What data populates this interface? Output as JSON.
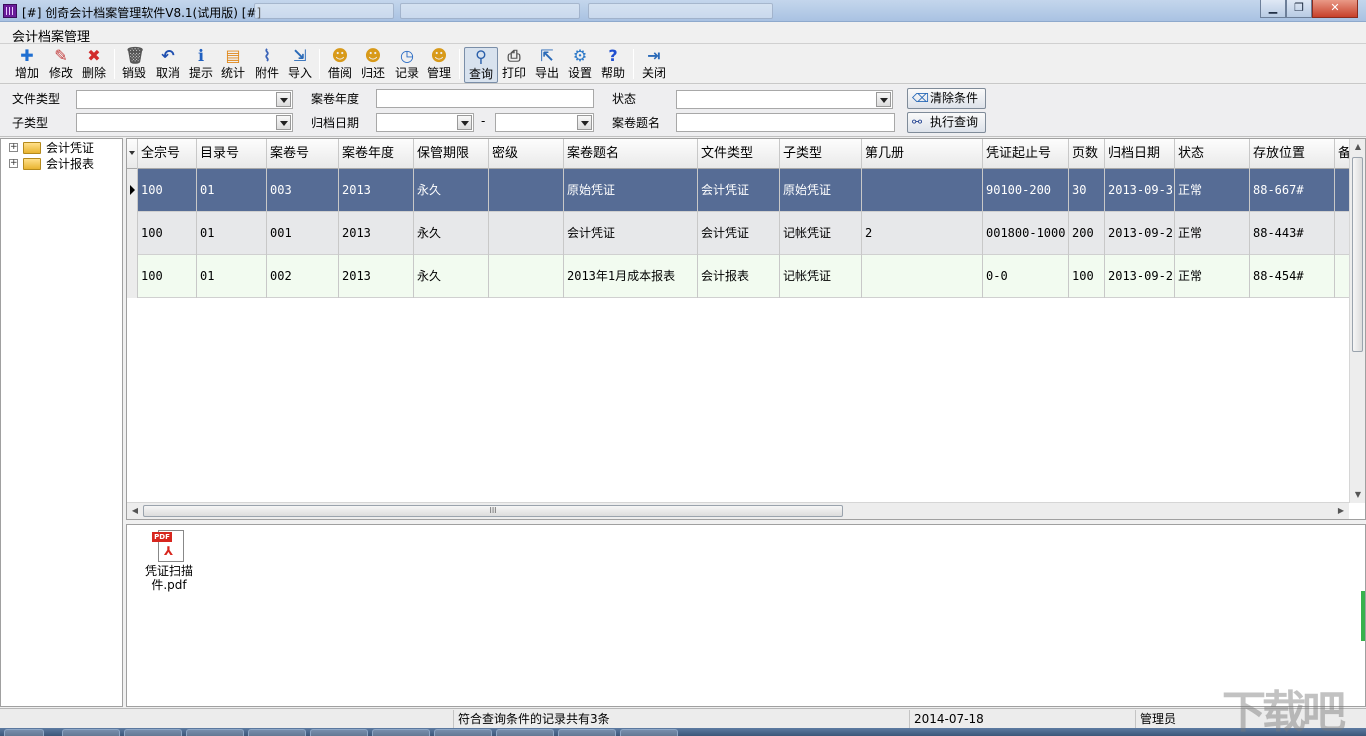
{
  "window": {
    "title": "[#] 创奇会计档案管理软件V8.1(试用版) [#]",
    "controls": {
      "minimize": "▁",
      "maximize": "❐",
      "close": "✕"
    }
  },
  "menu": {
    "title": "会计档案管理"
  },
  "toolbar": {
    "buttons": [
      {
        "label": "增加",
        "icon": "plus-icon",
        "glyph": "✚",
        "color": "#1f6fd1"
      },
      {
        "label": "修改",
        "icon": "pencil-icon",
        "glyph": "✎",
        "color": "#c23b3b"
      },
      {
        "label": "删除",
        "icon": "delete-x-icon",
        "glyph": "✖",
        "color": "#d22b2b"
      },
      {
        "label": "销毁",
        "icon": "trash-icon",
        "glyph": "🗑",
        "color": "#555555"
      },
      {
        "label": "取消",
        "icon": "undo-icon",
        "glyph": "↶",
        "color": "#1f4fb0"
      },
      {
        "label": "提示",
        "icon": "info-icon",
        "glyph": "ℹ",
        "color": "#1f5fc0"
      },
      {
        "label": "统计",
        "icon": "clipboard-icon",
        "glyph": "▤",
        "color": "#e0891c"
      },
      {
        "label": "附件",
        "icon": "paperclip-icon",
        "glyph": "⌇",
        "color": "#3a63b8"
      },
      {
        "label": "导入",
        "icon": "import-icon",
        "glyph": "⇲",
        "color": "#2a6ab8"
      },
      {
        "label": "借阅",
        "icon": "user-borrow-icon",
        "glyph": "☻",
        "color": "#d89a1a"
      },
      {
        "label": "归还",
        "icon": "user-return-icon",
        "glyph": "☻",
        "color": "#d89a1a"
      },
      {
        "label": "记录",
        "icon": "clock-icon",
        "glyph": "◷",
        "color": "#2b6cc4"
      },
      {
        "label": "管理",
        "icon": "user-manage-icon",
        "glyph": "☻",
        "color": "#d89a1a"
      },
      {
        "label": "查询",
        "icon": "magnifier-icon",
        "glyph": "⚲",
        "color": "#2a5faa"
      },
      {
        "label": "打印",
        "icon": "printer-icon",
        "glyph": "⎙",
        "color": "#555555"
      },
      {
        "label": "导出",
        "icon": "export-icon",
        "glyph": "⇱",
        "color": "#2a6ab8"
      },
      {
        "label": "设置",
        "icon": "gear-icon",
        "glyph": "⚙",
        "color": "#2b78c8"
      },
      {
        "label": "帮助",
        "icon": "help-icon",
        "glyph": "?",
        "color": "#1f4fd1"
      },
      {
        "label": "关闭",
        "icon": "exit-icon",
        "glyph": "⇥",
        "color": "#2a6ab8"
      }
    ]
  },
  "filters": {
    "file_type_label": "文件类型",
    "sub_type_label": "子类型",
    "year_label": "案卷年度",
    "archive_date_label": "归档日期",
    "date_separator": "-",
    "status_label": "状态",
    "title_label": "案卷题名",
    "clear_button": "清除条件",
    "query_button": "执行查询"
  },
  "tree": {
    "nodes": [
      {
        "label": "会计凭证"
      },
      {
        "label": "会计报表"
      }
    ]
  },
  "grid": {
    "columns": [
      "全宗号",
      "目录号",
      "案卷号",
      "案卷年度",
      "保管期限",
      "密级",
      "案卷题名",
      "文件类型",
      "子类型",
      "第几册",
      "凭证起止号",
      "页数",
      "归档日期",
      "状态",
      "存放位置",
      "备"
    ],
    "rows": [
      [
        "100",
        "01",
        "003",
        "2013",
        "永久",
        "",
        "原始凭证",
        "会计凭证",
        "原始凭证",
        "",
        "90100-200",
        "30",
        "2013-09-3",
        "正常",
        "88-667#",
        ""
      ],
      [
        "100",
        "01",
        "001",
        "2013",
        "永久",
        "",
        "会计凭证",
        "会计凭证",
        "记帐凭证",
        "2",
        "001800-1000",
        "200",
        "2013-09-2",
        "正常",
        "88-443#",
        ""
      ],
      [
        "100",
        "01",
        "002",
        "2013",
        "永久",
        "",
        "2013年1月成本报表",
        "会计报表",
        "记帐凭证",
        "",
        "0-0",
        "100",
        "2013-09-2",
        "正常",
        "88-454#",
        ""
      ]
    ],
    "selected_row": 0,
    "hscroll_grip": "III"
  },
  "attachment": {
    "file_label": "凭证扫描件.pdf",
    "pdf_tag": "PDF"
  },
  "status": {
    "count_text": "符合查询条件的记录共有3条",
    "date": "2014-07-18",
    "user": "管理员"
  },
  "watermark": "下载吧"
}
